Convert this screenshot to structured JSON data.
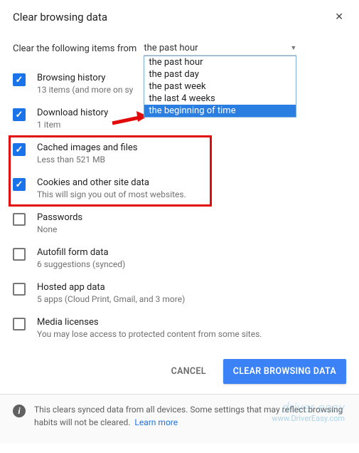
{
  "dialog": {
    "title": "Clear browsing data",
    "close_icon": "✕"
  },
  "from": {
    "label": "Clear the following items from",
    "selected": "the past hour",
    "options": [
      "the past hour",
      "the past day",
      "the past week",
      "the last 4 weeks",
      "the beginning of time"
    ],
    "highlighted_index": 4
  },
  "items": [
    {
      "checked": true,
      "label": "Browsing history",
      "sub": "13 items (and more on sy"
    },
    {
      "checked": true,
      "label": "Download history",
      "sub": "1 item"
    },
    {
      "checked": true,
      "label": "Cached images and files",
      "sub": "Less than 521 MB"
    },
    {
      "checked": true,
      "label": "Cookies and other site data",
      "sub": "This will sign you out of most websites."
    },
    {
      "checked": false,
      "label": "Passwords",
      "sub": "None"
    },
    {
      "checked": false,
      "label": "Autofill form data",
      "sub": "6 suggestions (synced)"
    },
    {
      "checked": false,
      "label": "Hosted app data",
      "sub": "5 apps (Cloud Print, Gmail, and 3 more)"
    },
    {
      "checked": false,
      "label": "Media licenses",
      "sub": "You may lose access to protected content from some sites."
    }
  ],
  "buttons": {
    "cancel": "CANCEL",
    "confirm": "CLEAR BROWSING DATA"
  },
  "footer": {
    "text": "This clears synced data from all devices. Some settings that may reflect browsing habits will not be cleared.",
    "learn_more": "Learn more"
  },
  "watermark": {
    "brand": "driver easy",
    "url": "www.DriverEasy.com"
  },
  "annotation": {
    "arrow_target": "the beginning of time",
    "red_box_items": [
      "Cached images and files",
      "Cookies and other site data"
    ]
  }
}
